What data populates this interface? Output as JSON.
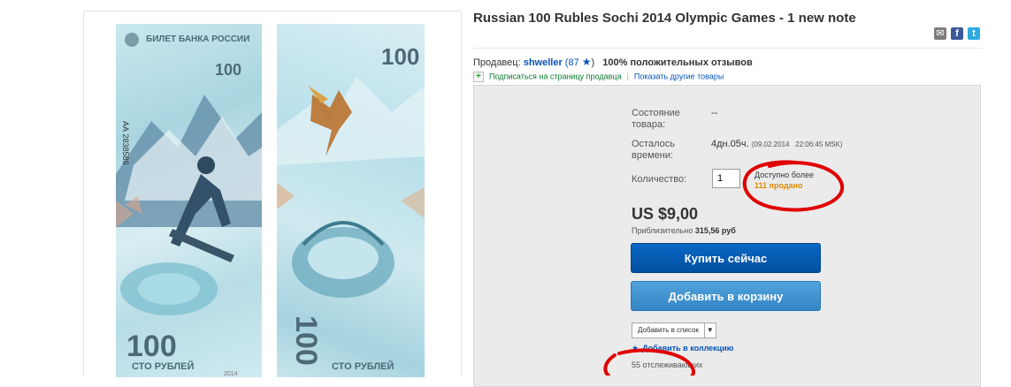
{
  "listing": {
    "title": "Russian 100 Rubles Sochi 2014 Olympic Games - 1 new note"
  },
  "share": {
    "mail_glyph": "✉",
    "facebook_glyph": "f",
    "twitter_glyph": "t"
  },
  "note_front": {
    "bank_text": "БИЛЕТ БАНКА РОССИИ",
    "denomination": "100",
    "denomination_words": "СТО РУБЛЕЙ",
    "serial": "АА 2838586",
    "year": "2014"
  },
  "note_back": {
    "denomination": "100",
    "denomination_words": "СТО РУБЛЕЙ"
  },
  "seller": {
    "label": "Продавец:",
    "name": "shweller",
    "score_open": "(87",
    "score_close": ")",
    "feedback": "100% положительных отзывов",
    "follow_link": "Подписаться на страницу продавца",
    "separator": "|",
    "other_items_link": "Показать другие товары"
  },
  "details": {
    "condition_label": "Состояние товара:",
    "condition_value": "--",
    "time_left_label": "Осталось времени:",
    "time_left_value": "4дн.05ч.",
    "time_left_end": "(09.02.2014   22:06:45 MSK)",
    "quantity_label": "Количество:",
    "quantity_value": "1",
    "available_text": "Доступно более",
    "sold_text": "111 продано"
  },
  "pricing": {
    "price": "US $9,00",
    "approx_label": "Приблизительно",
    "approx_value": "315,56 руб"
  },
  "actions": {
    "buy_now": "Купить сейчас",
    "add_to_cart": "Добавить в корзину",
    "add_to_list": "Добавить в список",
    "add_to_collection": "Добавить в коллекцию",
    "watchers": "55 отслеживающих"
  },
  "colors": {
    "link_blue": "#0654ba",
    "buy_button": "#0654ba",
    "cart_button": "#3f93d1",
    "sold_orange": "#e28a00",
    "annotation_red": "#e00000"
  }
}
